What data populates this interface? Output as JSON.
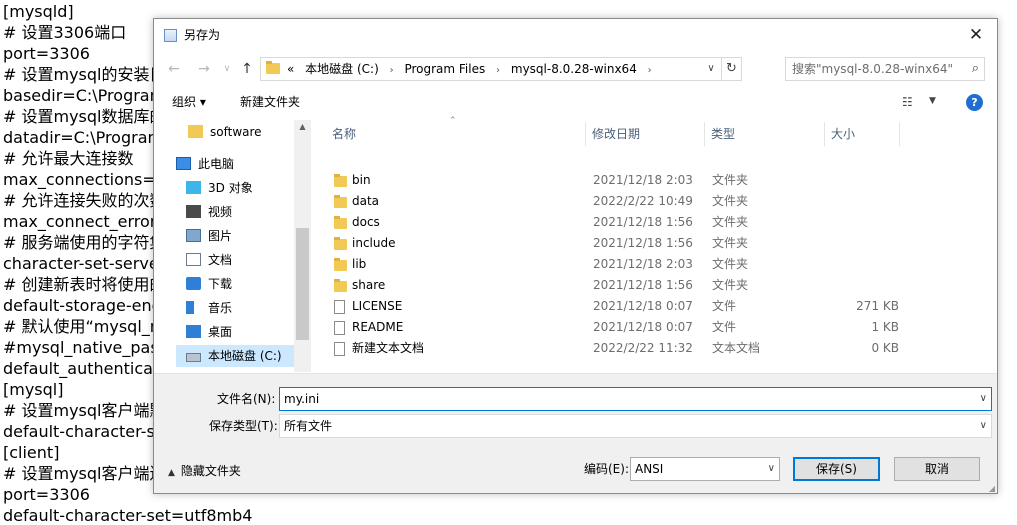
{
  "background_text": {
    "lines": [
      "[mysqld]",
      "# 设置3306端口",
      "port=3306",
      "# 设置mysql的安装目",
      "basedir=C:\\Program",
      "# 设置mysql数据库的",
      "datadir=C:\\Program",
      "# 允许最大连接数",
      "max_connections=2",
      "# 允许连接失败的次数",
      "max_connect_errors",
      "# 服务端使用的字符集",
      "character-set-server",
      "# 创建新表时将使用的",
      "default-storage-eng",
      "# 默认使用“mysql_n",
      "#mysql_native_passw",
      "default_authenticati",
      "[mysql]",
      "# 设置mysql客户端默",
      "default-character-se",
      "[client]",
      "# 设置mysql客户端连",
      "port=3306",
      "default-character-set=utf8mb4"
    ]
  },
  "dialog": {
    "title": "另存为",
    "close_glyph": "✕",
    "nav": {
      "back": "←",
      "forward": "→",
      "recent": "∨",
      "up": "↑"
    },
    "address": {
      "prefix": "«",
      "crumbs": [
        "本地磁盘 (C:)",
        "Program Files",
        "mysql-8.0.28-winx64"
      ],
      "separator": "›",
      "dropdown": "∨",
      "refresh": "↻"
    },
    "search": {
      "placeholder": "搜索\"mysql-8.0.28-winx64\"",
      "icon": "⌕"
    },
    "toolbar": {
      "organize": "组织 ▾",
      "new_folder": "新建文件夹",
      "view_icon": "☷",
      "view_dropdown": "▼",
      "help": "?"
    },
    "nav_pane": {
      "items": [
        {
          "label": "software",
          "icon": "folder-icon"
        },
        {
          "label": "此电脑",
          "icon": "computer-icon"
        },
        {
          "label": "3D 对象",
          "icon": "cube-icon"
        },
        {
          "label": "视频",
          "icon": "video-icon"
        },
        {
          "label": "图片",
          "icon": "picture-icon"
        },
        {
          "label": "文档",
          "icon": "document-icon"
        },
        {
          "label": "下载",
          "icon": "download-icon"
        },
        {
          "label": "音乐",
          "icon": "music-icon"
        },
        {
          "label": "桌面",
          "icon": "desktop-icon"
        },
        {
          "label": "本地磁盘 (C:)",
          "icon": "drive-icon"
        }
      ],
      "selected_index": 9
    },
    "columns": {
      "name": "名称",
      "date": "修改日期",
      "type": "类型",
      "size": "大小"
    },
    "files": [
      {
        "name": "bin",
        "date": "2021/12/18 2:03",
        "type": "文件夹",
        "size": "",
        "kind": "folder"
      },
      {
        "name": "data",
        "date": "2022/2/22 10:49",
        "type": "文件夹",
        "size": "",
        "kind": "folder"
      },
      {
        "name": "docs",
        "date": "2021/12/18 1:56",
        "type": "文件夹",
        "size": "",
        "kind": "folder"
      },
      {
        "name": "include",
        "date": "2021/12/18 1:56",
        "type": "文件夹",
        "size": "",
        "kind": "folder"
      },
      {
        "name": "lib",
        "date": "2021/12/18 2:03",
        "type": "文件夹",
        "size": "",
        "kind": "folder"
      },
      {
        "name": "share",
        "date": "2021/12/18 1:56",
        "type": "文件夹",
        "size": "",
        "kind": "folder"
      },
      {
        "name": "LICENSE",
        "date": "2021/12/18 0:07",
        "type": "文件",
        "size": "271 KB",
        "kind": "file"
      },
      {
        "name": "README",
        "date": "2021/12/18 0:07",
        "type": "文件",
        "size": "1 KB",
        "kind": "file"
      },
      {
        "name": "新建文本文档",
        "date": "2022/2/22 11:32",
        "type": "文本文档",
        "size": "0 KB",
        "kind": "file"
      }
    ],
    "filename": {
      "label": "文件名(N):",
      "value": "my.ini"
    },
    "filetype": {
      "label": "保存类型(T):",
      "value": "所有文件"
    },
    "hide_folders": "隐藏文件夹",
    "encoding": {
      "label": "编码(E):",
      "value": "ANSI"
    },
    "save_label": "保存(S)",
    "cancel_label": "取消",
    "colors": {
      "accent": "#0078d7",
      "selection": "#cce8ff",
      "folder": "#f3c956"
    }
  }
}
